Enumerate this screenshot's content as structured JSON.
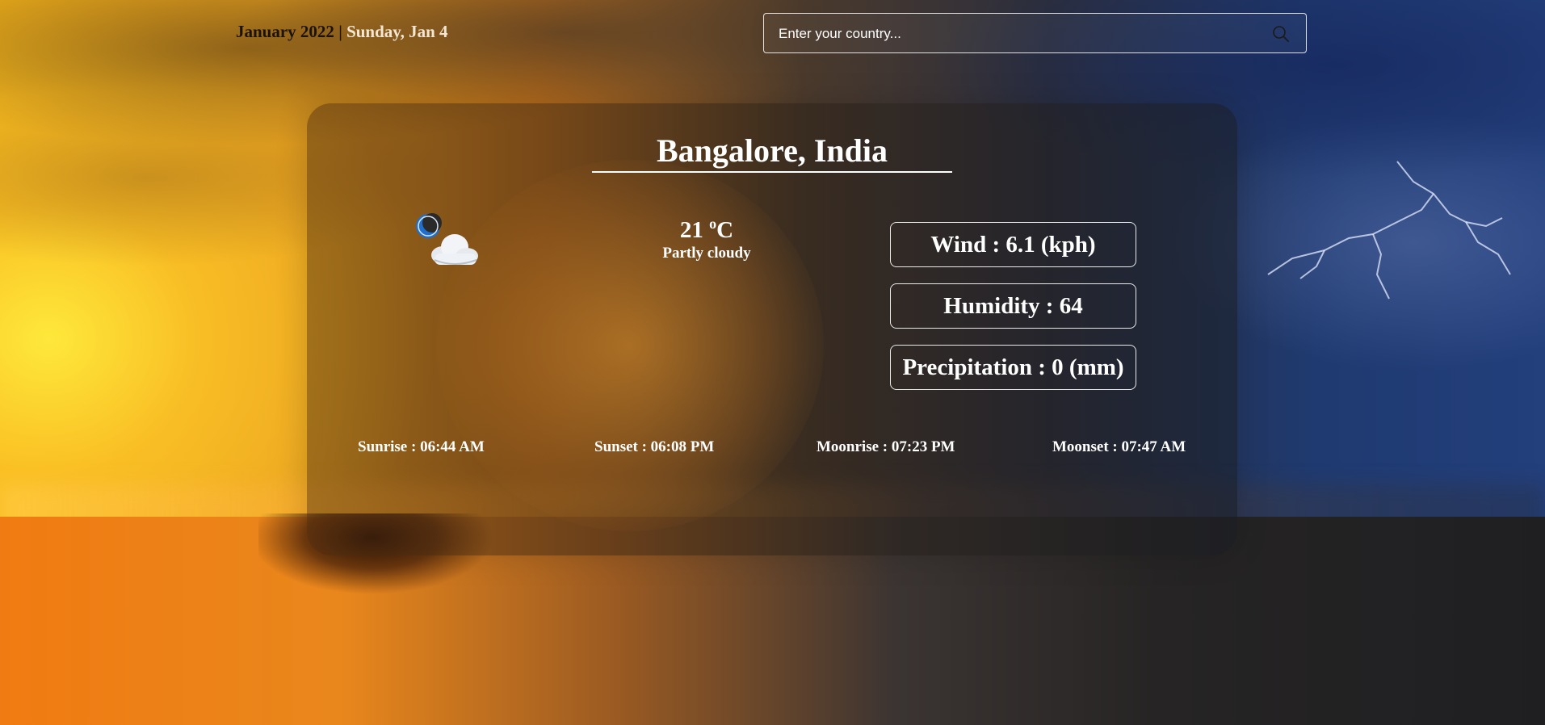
{
  "header": {
    "month_year": "January 2022",
    "separator": " | ",
    "day_date": "Sunday, Jan 4"
  },
  "search": {
    "placeholder": "Enter your country...",
    "value": "",
    "icon": "search-icon"
  },
  "weather": {
    "location": "Bangalore, India",
    "temperature_value": "21 ",
    "degree_symbol": "o",
    "temperature_unit": "C",
    "condition": "Partly cloudy",
    "condition_icon": "moon-cloud-icon",
    "wind": "Wind : 6.1 (kph)",
    "humidity": "Humidity : 64",
    "precipitation": "Precipitation : 0 (mm)"
  },
  "astro": {
    "sunrise": "Sunrise : 06:44 AM",
    "sunset": "Sunset : 06:08 PM",
    "moonrise": "Moonrise : 07:23 PM",
    "moonset": "Moonset : 07:47 AM"
  }
}
